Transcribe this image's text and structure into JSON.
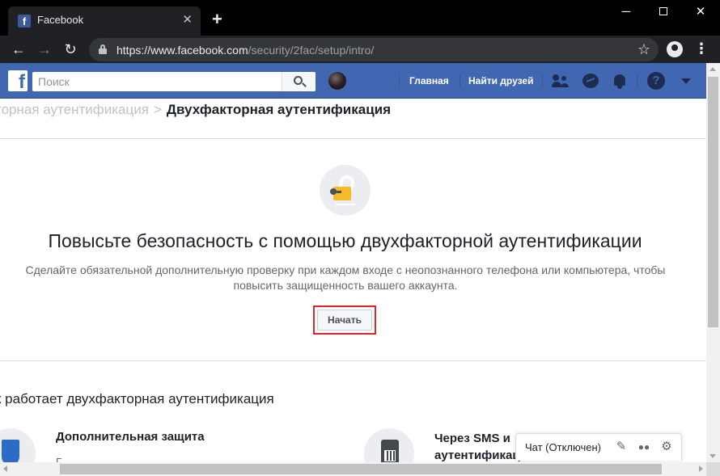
{
  "browser": {
    "tab_title": "Facebook",
    "tab_close": "✕",
    "new_tab": "+",
    "url_host": "https://www.facebook.com",
    "url_path": "/security/2fac/setup/intro/",
    "window_controls": {
      "minimize": "─",
      "close": "✕"
    }
  },
  "fb_header": {
    "search_placeholder": "Поиск",
    "nav_home": "Главная",
    "nav_find_friends": "Найти друзей",
    "help_glyph": "?"
  },
  "breadcrumb": {
    "parent": "торная аутентификация",
    "separator": ">",
    "current": "Двухфакторная аутентификация"
  },
  "intro": {
    "title": "Повысьте безопасность с помощью двухфакторной аутентификации",
    "description": "Сделайте обязательной дополнительную проверку при каждом входе с неопознанного телефона или компьютера, чтобы повысить защищенность вашего аккаунта.",
    "start_button": "Начать"
  },
  "how_it_works": {
    "title": "к работает двухфакторная аутентификация",
    "feature_1_title": "Дополнительная защита",
    "feature_1_desc": "Г",
    "feature_2_title": "Через SMS и аутентификац"
  },
  "chat": {
    "label": "Чат (Отключен)"
  },
  "icons": {
    "facebook_logo": "f",
    "back": "←",
    "forward": "→",
    "reload": "↻",
    "star": "☆",
    "menu": "⋮",
    "compose": "✎",
    "group": "👥",
    "settings": "⚙"
  },
  "colors": {
    "fb_blue": "#4267b2",
    "lock_yellow": "#f7b928",
    "highlight_red": "#e0252d"
  }
}
